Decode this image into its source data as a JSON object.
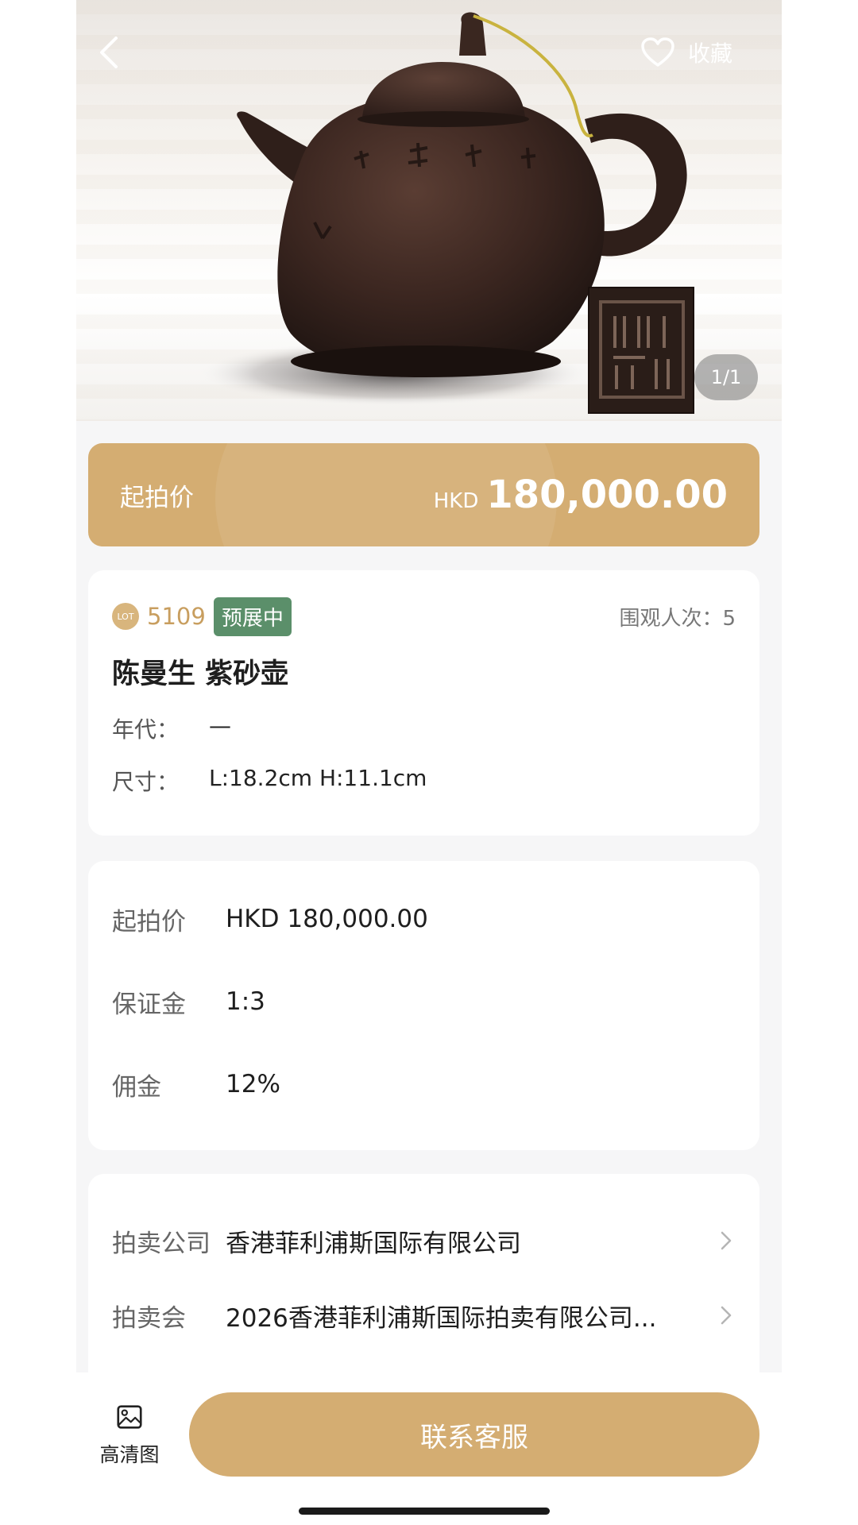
{
  "gallery": {
    "page_indicator": "1/1"
  },
  "header": {
    "favorite_label": "收藏",
    "back_icon": "chevron-left-icon",
    "favorite_icon": "heart-outline-icon"
  },
  "price_banner": {
    "label": "起拍价",
    "currency": "HKD",
    "amount": "180,000.00"
  },
  "lot": {
    "lot_icon_text": "LOT",
    "number": "5109",
    "status": "预展中",
    "viewers": "围观人次：5",
    "title": "陈曼生 紫砂壶",
    "specs": [
      {
        "label": "年代：",
        "value": "—"
      },
      {
        "label": "尺寸：",
        "value": "L:18.2cm H:11.1cm"
      }
    ]
  },
  "fees": [
    {
      "label": "起拍价",
      "value": "HKD 180,000.00"
    },
    {
      "label": "保证金",
      "value": "1:3"
    },
    {
      "label": "佣金",
      "value": "12%"
    }
  ],
  "company": [
    {
      "label": "拍卖公司",
      "value": "香港菲利浦斯国际有限公司"
    },
    {
      "label": "拍卖会",
      "value": "2026香港菲利浦斯国际拍卖有限公司..."
    }
  ],
  "bottom": {
    "hd_label": "高清图",
    "hd_icon": "image-icon",
    "contact_label": "联系客服"
  },
  "colors": {
    "accent": "#d4ad72",
    "status_green": "#5b8f6a",
    "lot_gold": "#c89e5f"
  }
}
